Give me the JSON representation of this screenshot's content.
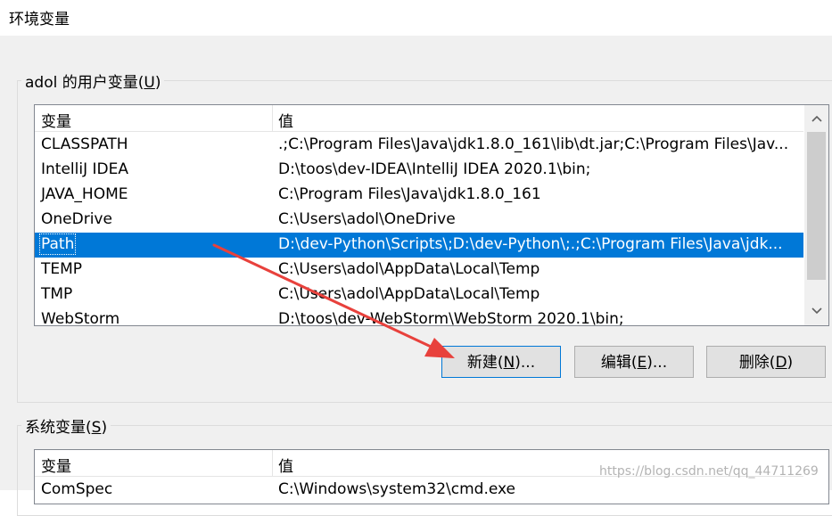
{
  "window": {
    "title": "环境变量"
  },
  "user_vars": {
    "group_prefix": "adol 的用户变量(",
    "group_key": "U",
    "group_suffix": ")",
    "columns": [
      "变量",
      "值"
    ],
    "rows": [
      {
        "name": "CLASSPATH",
        "value": ".;C:\\Program Files\\Java\\jdk1.8.0_161\\lib\\dt.jar;C:\\Program Files\\Jav..."
      },
      {
        "name": "IntelliJ IDEA",
        "value": "D:\\toos\\dev-IDEA\\IntelliJ IDEA 2020.1\\bin;"
      },
      {
        "name": "JAVA_HOME",
        "value": "C:\\Program Files\\Java\\jdk1.8.0_161"
      },
      {
        "name": "OneDrive",
        "value": "C:\\Users\\adol\\OneDrive"
      },
      {
        "name": "Path",
        "value": "D:\\dev-Python\\Scripts\\;D:\\dev-Python\\;.;C:\\Program Files\\Java\\jdk..."
      },
      {
        "name": "TEMP",
        "value": "C:\\Users\\adol\\AppData\\Local\\Temp"
      },
      {
        "name": "TMP",
        "value": "C:\\Users\\adol\\AppData\\Local\\Temp"
      },
      {
        "name": "WebStorm",
        "value": "D:\\toos\\dev-WebStorm\\WebStorm 2020.1\\bin;"
      }
    ],
    "selected_name": "Path"
  },
  "buttons": {
    "new": {
      "prefix": "新建(",
      "key": "N",
      "suffix": ")..."
    },
    "edit": {
      "prefix": "编辑(",
      "key": "E",
      "suffix": ")..."
    },
    "delete": {
      "prefix": "删除(",
      "key": "D",
      "suffix": ")"
    }
  },
  "system_vars": {
    "group_prefix": "系统变量(",
    "group_key": "S",
    "group_suffix": ")",
    "columns": [
      "变量",
      "值"
    ],
    "rows": [
      {
        "name": "ComSpec",
        "value": "C:\\Windows\\system32\\cmd.exe"
      }
    ]
  },
  "watermark": "https://blog.csdn.net/qq_44711269",
  "colors": {
    "selection": "#0078d7",
    "annotation_arrow": "#e8413c"
  },
  "icons": {
    "scroll_up": "chevron-up-icon",
    "scroll_down": "chevron-down-icon"
  }
}
